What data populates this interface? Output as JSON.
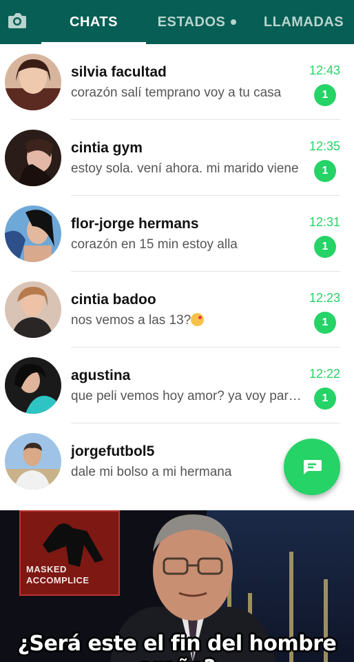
{
  "tabs": [
    {
      "label": "CHATS",
      "active": true
    },
    {
      "label": "ESTADOS",
      "active": false
    },
    {
      "label": "LLAMADAS",
      "active": false
    }
  ],
  "chats": [
    {
      "name": "silvia facultad",
      "message": "corazón salí temprano voy a tu casa",
      "time": "12:43",
      "unread": "1"
    },
    {
      "name": "cintia gym",
      "message": "estoy sola. vení ahora. mi marido viene",
      "time": "12:35",
      "unread": "1"
    },
    {
      "name": "flor-jorge hermans",
      "message": "corazón en 15 min estoy alla",
      "time": "12:31",
      "unread": "1"
    },
    {
      "name": "cintia badoo",
      "message": "nos vemos a las 13?",
      "time": "12:23",
      "unread": "1"
    },
    {
      "name": "agustina",
      "message": "que peli vemos hoy amor? ya voy para allá",
      "time": "12:22",
      "unread": "1"
    },
    {
      "name": "jorgefutbol5",
      "message": "dale mi bolso a mi hermana",
      "time": "",
      "unread": ""
    }
  ],
  "meme": {
    "box_label_line1": "MASKED",
    "box_label_line2": "ACCOMPLICE",
    "caption": "¿Será este el fin del hombre araña?"
  },
  "colors": {
    "header": "#075e54",
    "accent": "#25d366"
  },
  "icons": {
    "camera": "camera-icon",
    "compose": "new-chat-icon",
    "emoji": "kiss-emoji-icon"
  }
}
